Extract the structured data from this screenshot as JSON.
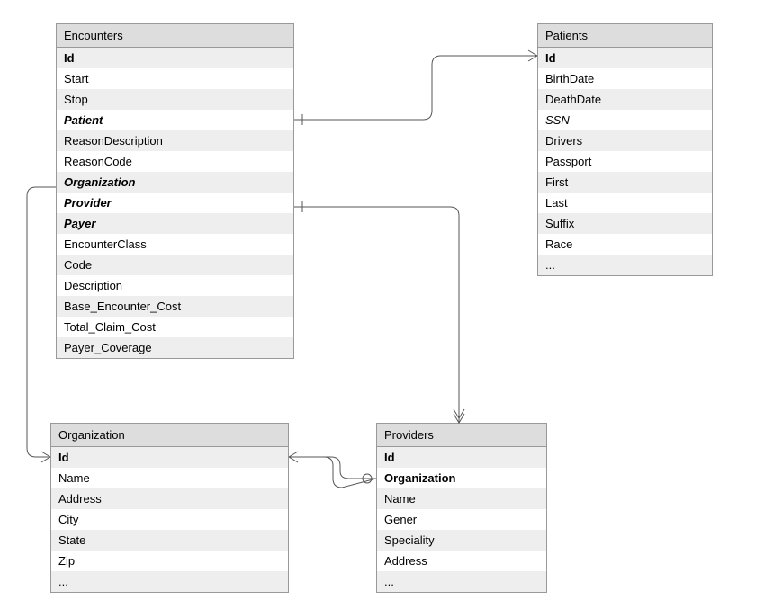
{
  "entities": {
    "encounters": {
      "title": "Encounters",
      "rows": [
        {
          "label": "Id",
          "bold": true
        },
        {
          "label": "Start"
        },
        {
          "label": "Stop"
        },
        {
          "label": "Patient",
          "bold": true,
          "italic": true
        },
        {
          "label": "ReasonDescription"
        },
        {
          "label": "ReasonCode"
        },
        {
          "label": "Organization",
          "bold": true,
          "italic": true
        },
        {
          "label": "Provider",
          "bold": true,
          "italic": true
        },
        {
          "label": "Payer",
          "bold": true,
          "italic": true
        },
        {
          "label": "EncounterClass"
        },
        {
          "label": "Code"
        },
        {
          "label": "Description"
        },
        {
          "label": "Base_Encounter_Cost"
        },
        {
          "label": "Total_Claim_Cost"
        },
        {
          "label": "Payer_Coverage"
        }
      ]
    },
    "patients": {
      "title": "Patients",
      "rows": [
        {
          "label": "Id",
          "bold": true
        },
        {
          "label": "BirthDate"
        },
        {
          "label": "DeathDate"
        },
        {
          "label": "SSN",
          "italic": true
        },
        {
          "label": "Drivers"
        },
        {
          "label": "Passport"
        },
        {
          "label": "First"
        },
        {
          "label": "Last"
        },
        {
          "label": "Suffix"
        },
        {
          "label": "Race"
        },
        {
          "label": "..."
        }
      ]
    },
    "organization": {
      "title": "Organization",
      "rows": [
        {
          "label": "Id",
          "bold": true
        },
        {
          "label": "Name"
        },
        {
          "label": "Address"
        },
        {
          "label": "City"
        },
        {
          "label": "State"
        },
        {
          "label": "Zip"
        },
        {
          "label": "..."
        }
      ]
    },
    "providers": {
      "title": "Providers",
      "rows": [
        {
          "label": "Id",
          "bold": true
        },
        {
          "label": "Organization",
          "bold": true
        },
        {
          "label": "Name"
        },
        {
          "label": "Gener"
        },
        {
          "label": "Speciality"
        },
        {
          "label": "Address"
        },
        {
          "label": "..."
        }
      ]
    }
  }
}
